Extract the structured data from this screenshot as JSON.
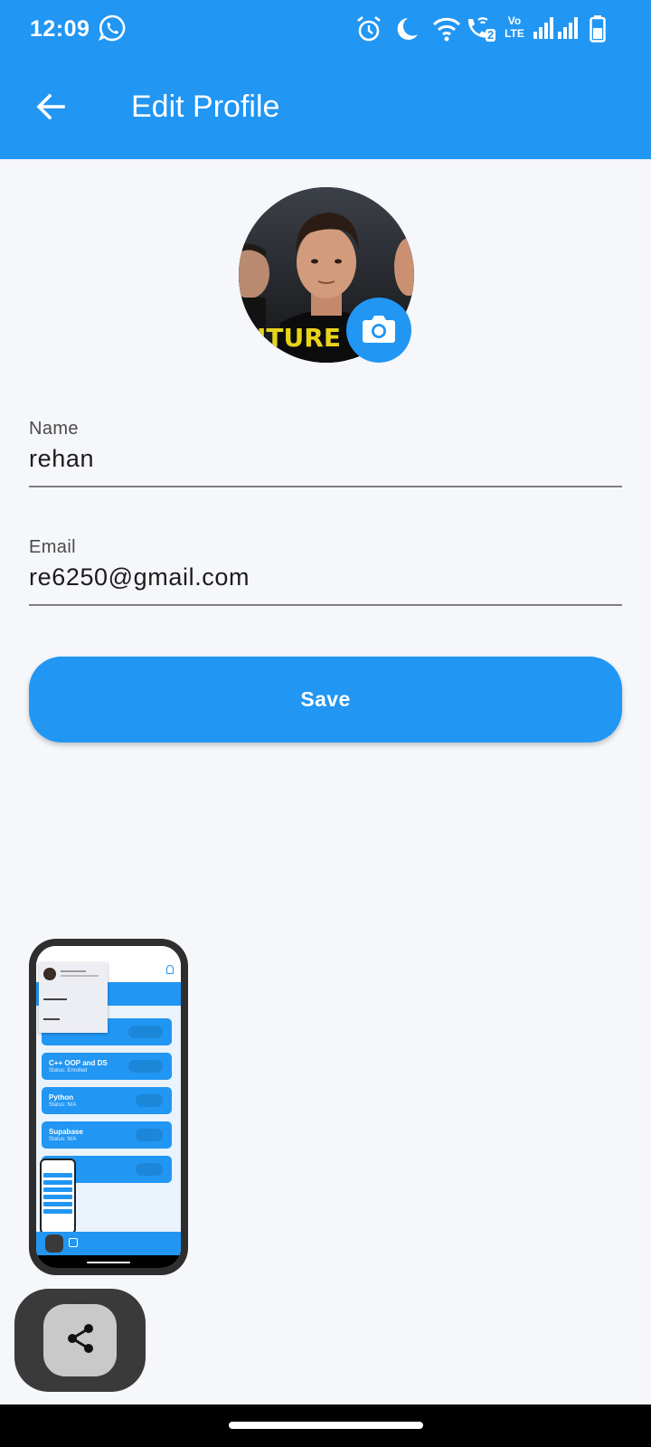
{
  "status_bar": {
    "time": "12:09",
    "icons": [
      "whatsapp-icon",
      "alarm-icon",
      "moon-icon",
      "wifi-icon",
      "wifi-call-icon",
      "volte-icon",
      "signal-icon",
      "signal-icon-2",
      "battery-icon"
    ],
    "sim_label": "2",
    "volte_label": "Vo LTE"
  },
  "app_bar": {
    "title": "Edit Profile",
    "back_icon": "arrow-back-icon",
    "color": "#2196f3"
  },
  "avatar": {
    "camera_icon": "camera-icon",
    "shirt_text": "ITURE"
  },
  "form": {
    "name_label": "Name",
    "name_value": "rehan",
    "email_label": "Email",
    "email_value": "re6250@gmail.com"
  },
  "save_button": {
    "label": "Save"
  },
  "preview": {
    "cards": [
      {
        "title": "",
        "sub": ""
      },
      {
        "title": "C++ OOP and DS",
        "sub": "Status: Enrolled"
      },
      {
        "title": "Python",
        "sub": "Status: N/A"
      },
      {
        "title": "Supabase",
        "sub": "Status: N/A"
      },
      {
        "title": "",
        "sub": ""
      }
    ]
  },
  "share_fab": {
    "icon": "share-icon"
  }
}
